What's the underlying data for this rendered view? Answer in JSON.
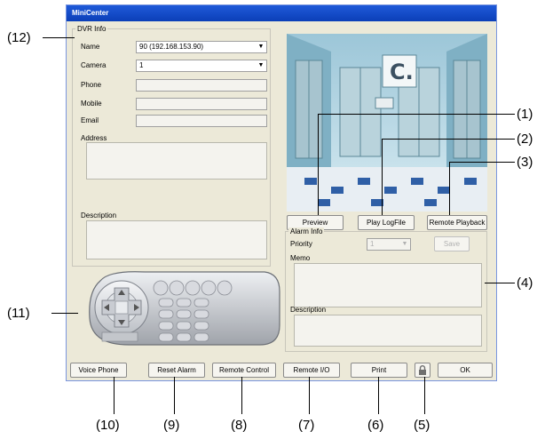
{
  "window": {
    "title": "MiniCenter"
  },
  "dvr_info": {
    "group_label": "DVR Info",
    "name_label": "Name",
    "name_value": "90 (192.168.153.90)",
    "camera_label": "Camera",
    "camera_value": "1",
    "phone_label": "Phone",
    "mobile_label": "Mobile",
    "email_label": "Email",
    "address_label": "Address",
    "description_label": "Description"
  },
  "preview": {
    "sign_text": "C."
  },
  "buttons": {
    "preview": "Preview",
    "play_logfile": "Play LogFile",
    "remote_playback": "Remote Playback",
    "voice_phone": "Voice Phone",
    "reset_alarm": "Reset Alarm",
    "remote_control": "Remote Control",
    "remote_io": "Remote I/O",
    "print": "Print",
    "ok": "OK"
  },
  "alarm_info": {
    "group_label": "Alarm Info",
    "priority_label": "Priority",
    "priority_value": "1",
    "save_label": "Save",
    "memo_label": "Memo",
    "description_label": "Description"
  },
  "callouts": {
    "c1": "(1)",
    "c2": "(2)",
    "c3": "(3)",
    "c4": "(4)",
    "c5": "(5)",
    "c6": "(6)",
    "c7": "(7)",
    "c8": "(8)",
    "c9": "(9)",
    "c10": "(10)",
    "c11": "(11)",
    "c12": "(12)"
  }
}
